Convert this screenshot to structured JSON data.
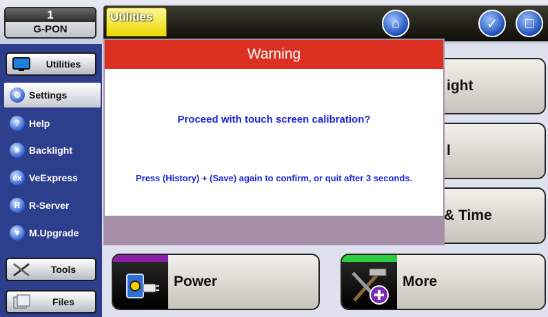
{
  "header": {
    "port_number": "1",
    "port_label": "G-PON",
    "section_tab": "Utilities",
    "buttons": [
      "home-icon",
      "tools-check-icon",
      "folder-icon"
    ]
  },
  "sidebar": {
    "top_button": "Utilities",
    "items": [
      {
        "label": "Settings",
        "icon": "settings-icon",
        "active": true
      },
      {
        "label": "Help",
        "icon": "help-icon"
      },
      {
        "label": "Backlight",
        "icon": "backlight-icon"
      },
      {
        "label": "VeExpress",
        "icon": "veexpress-icon"
      },
      {
        "label": "R-Server",
        "icon": "r-server-icon"
      },
      {
        "label": "M.Upgrade",
        "icon": "upgrade-icon"
      }
    ],
    "tools_button": "Tools",
    "files_button": "Files"
  },
  "tiles": {
    "backlight_partial": "ight",
    "terminal_partial": "l",
    "datetime_partial": "& Time",
    "power": "Power",
    "more": "More",
    "power_stripe_color": "#8b1fa8",
    "more_stripe_color": "#2ecc40"
  },
  "dialog": {
    "title": "Warning",
    "question": "Proceed with touch screen calibration?",
    "instruction": "Press (History) + (Save) again to confirm, or quit after 3 seconds.",
    "header_color": "#dc3122",
    "text_color": "#1e24d8"
  }
}
